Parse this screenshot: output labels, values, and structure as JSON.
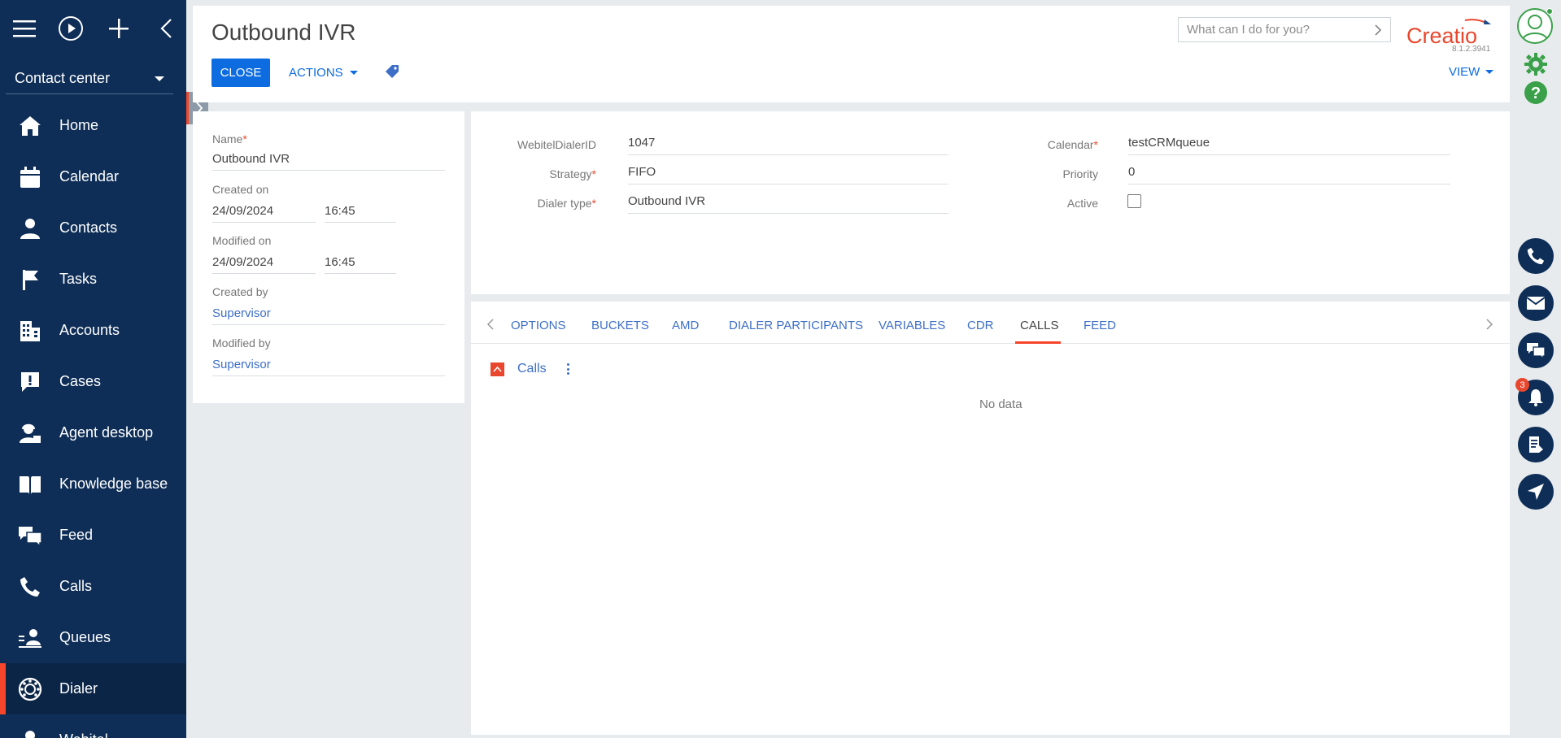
{
  "sidebar": {
    "workplace": "Contact center",
    "items": [
      {
        "label": "Home",
        "icon": "home-icon"
      },
      {
        "label": "Calendar",
        "icon": "calendar-icon"
      },
      {
        "label": "Contacts",
        "icon": "contact-icon"
      },
      {
        "label": "Tasks",
        "icon": "flag-icon"
      },
      {
        "label": "Accounts",
        "icon": "building-icon"
      },
      {
        "label": "Cases",
        "icon": "case-icon"
      },
      {
        "label": "Agent desktop",
        "icon": "agent-icon"
      },
      {
        "label": "Knowledge base",
        "icon": "book-icon"
      },
      {
        "label": "Feed",
        "icon": "feed-icon"
      },
      {
        "label": "Calls",
        "icon": "phone-icon"
      },
      {
        "label": "Queues",
        "icon": "queue-icon"
      },
      {
        "label": "Dialer",
        "icon": "dialer-icon",
        "active": true
      },
      {
        "label": "Webitel",
        "icon": "webitel-icon"
      }
    ]
  },
  "header": {
    "title": "Outbound IVR",
    "close_label": "CLOSE",
    "actions_label": "ACTIONS",
    "view_label": "VIEW",
    "search_placeholder": "What can I do for you?",
    "version": "8.1.2.3941",
    "logo_text": "Creatio"
  },
  "info": {
    "name_label": "Name",
    "name_value": "Outbound IVR",
    "created_on_label": "Created on",
    "created_on_date": "24/09/2024",
    "created_on_time": "16:45",
    "modified_on_label": "Modified on",
    "modified_on_date": "24/09/2024",
    "modified_on_time": "16:45",
    "created_by_label": "Created by",
    "created_by_value": "Supervisor",
    "modified_by_label": "Modified by",
    "modified_by_value": "Supervisor"
  },
  "fields": {
    "webitel_label": "WebitelDialerID",
    "webitel_value": "1047",
    "strategy_label": "Strategy",
    "strategy_value": "FIFO",
    "dialer_type_label": "Dialer type",
    "dialer_type_value": "Outbound IVR",
    "calendar_label": "Calendar",
    "calendar_value": "testCRMqueue",
    "priority_label": "Priority",
    "priority_value": "0",
    "active_label": "Active",
    "active_checked": false
  },
  "tabs": {
    "items": [
      "OPTIONS",
      "BUCKETS",
      "AMD",
      "DIALER PARTICIPANTS",
      "VARIABLES",
      "CDR",
      "CALLS",
      "FEED"
    ],
    "active": "CALLS",
    "section_title": "Calls",
    "no_data": "No data"
  },
  "rightbar": {
    "notification_count": "3"
  },
  "colors": {
    "sidebar_bg": "#0e2e57",
    "accent_red": "#f5452a",
    "primary_blue": "#0d6ce0",
    "link_blue": "#3d6fc6"
  }
}
